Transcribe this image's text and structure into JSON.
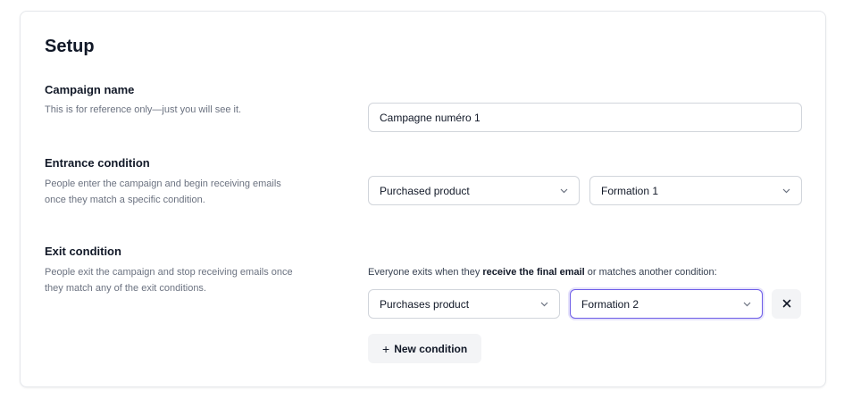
{
  "page": {
    "title": "Setup"
  },
  "campaign_name": {
    "title": "Campaign name",
    "description": "This is for reference only—just you will see it.",
    "value": "Campagne numéro 1"
  },
  "entrance": {
    "title": "Entrance condition",
    "description": "People enter the campaign and begin receiving emails once they match a specific condition.",
    "trigger": "Purchased product",
    "product": "Formation 1"
  },
  "exit": {
    "title": "Exit condition",
    "description": "People exit the campaign and stop receiving emails once they match any of the exit conditions.",
    "note_prefix": "Everyone exits when they ",
    "note_bold": "receive the final email",
    "note_suffix": " or matches another condition:",
    "condition_trigger": "Purchases product",
    "condition_product": "Formation 2",
    "new_condition_label": "New condition",
    "new_condition_icon": "+"
  },
  "colors": {
    "focus": "#6d5ce7",
    "muted_text": "#6b7280",
    "button_bg": "#f3f4f6"
  }
}
